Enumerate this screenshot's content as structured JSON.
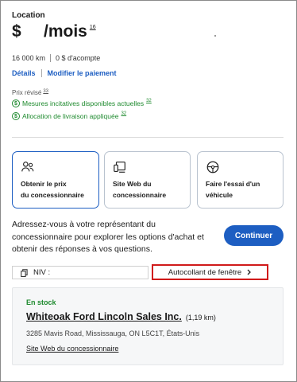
{
  "lease": {
    "label": "Location",
    "currency": "$",
    "per_month": "/mois",
    "per_month_footnote": "16",
    "mileage": "16 000 km",
    "down_payment": "0 $ d'acompte",
    "details_link": "Détails",
    "modify_payment_link": "Modifier le paiement"
  },
  "revised_price": {
    "label": "Prix révisé",
    "footnote": "33",
    "incentives": [
      {
        "icon": "dollar-coin-icon",
        "label": "Mesures incitatives disponibles actuelles",
        "footnote": "32"
      },
      {
        "icon": "dollar-coin-icon",
        "label": "Allocation de livraison appliquée",
        "footnote": "32"
      }
    ]
  },
  "action_cards": [
    {
      "name": "dealer-price",
      "icon": "people-icon",
      "line1": "Obtenir le prix",
      "line2": "du concessionnaire"
    },
    {
      "name": "dealer-website",
      "icon": "devices-icon",
      "line1": "Site Web du",
      "line2": "concessionnaire"
    },
    {
      "name": "test-drive",
      "icon": "steering-wheel-icon",
      "line1": "Faire l'essai d'un",
      "line2": "véhicule"
    }
  ],
  "representative": {
    "text": "Adressez-vous à votre représentant du concessionnaire pour explorer les options d'achat et obtenir des réponses à vos questions.",
    "continue_label": "Continuer"
  },
  "vin": {
    "label": "NIV :",
    "icon": "copy-icon"
  },
  "window_sticker": {
    "label": "Autocollant de fenêtre",
    "icon": "chevron-right-icon"
  },
  "dealer": {
    "stock_status": "En stock",
    "name": "Whiteoak Ford Lincoln Sales Inc.",
    "distance": "(1,19 km)",
    "address": "3285 Mavis Road, Mississauga, ON L5C1T, États-Unis",
    "website_link": "Site Web du concessionnaire"
  },
  "colors": {
    "accent": "#1d5ec2",
    "success": "#1e8a2e",
    "highlight_border": "#d01a1a"
  }
}
